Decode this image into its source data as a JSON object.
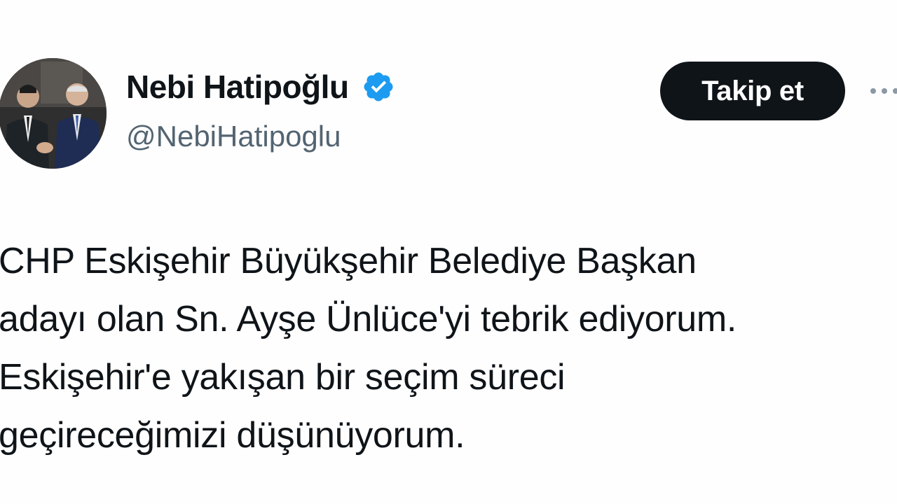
{
  "author": {
    "display_name": "Nebi Hatipoğlu",
    "handle": "@NebiHatipoglu",
    "verified_icon": "verified-badge-icon",
    "verified_color": "#1d9bf0"
  },
  "actions": {
    "follow_label": "Takip et",
    "more_icon": "more-options-icon"
  },
  "tweet": {
    "lines": [
      "CHP Eskişehir Büyükşehir Belediye Başkan",
      "adayı olan Sn. Ayşe Ünlüce'yi tebrik ediyorum.",
      "Eskişehir'e yakışan bir seçim süreci",
      "geçireceğimizi düşünüyorum."
    ]
  },
  "colors": {
    "text_primary": "#0f1419",
    "text_secondary": "#536471",
    "button_bg": "#0f1419",
    "button_text": "#ffffff"
  }
}
